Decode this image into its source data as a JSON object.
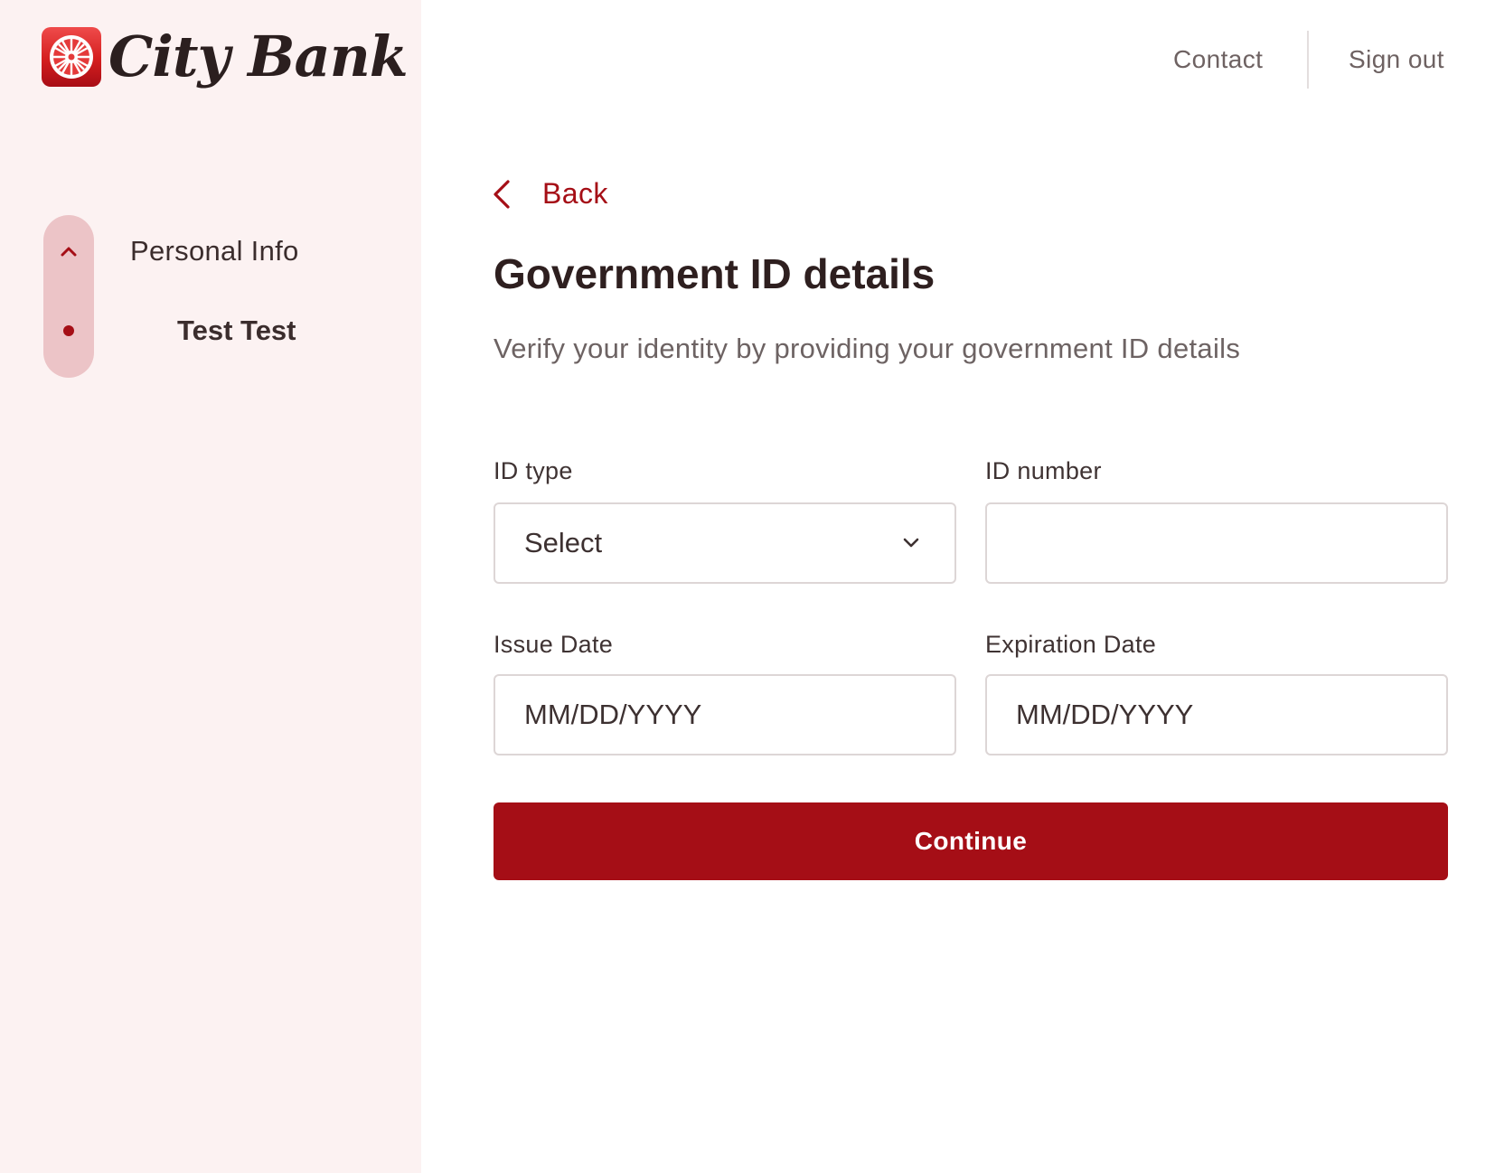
{
  "brand": {
    "name": "City Bank",
    "accent_color": "#a50e16",
    "logo_icon": "city-bank-logo-icon"
  },
  "topnav": {
    "contact_label": "Contact",
    "signout_label": "Sign out"
  },
  "sidebar": {
    "step_label": "Personal Info",
    "step_icon": "chevron-up-icon",
    "substep_label": "Test Test"
  },
  "main": {
    "back_label": "Back",
    "title": "Government ID details",
    "subtitle": "Verify your identity by providing your government ID details",
    "form": {
      "id_type": {
        "label": "ID type",
        "value": "Select"
      },
      "id_number": {
        "label": "ID number",
        "value": ""
      },
      "issue_date": {
        "label": "Issue Date",
        "placeholder": "MM/DD/YYYY"
      },
      "expiration_date": {
        "label": "Expiration Date",
        "placeholder": "MM/DD/YYYY"
      }
    },
    "continue_label": "Continue"
  }
}
